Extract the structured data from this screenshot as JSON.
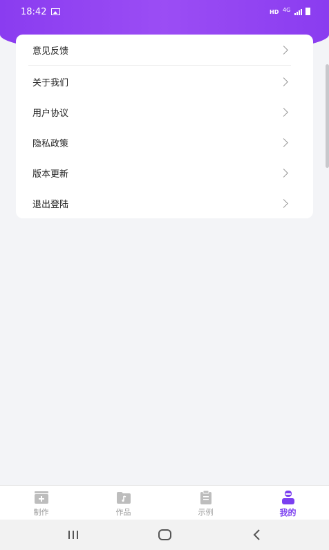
{
  "status_bar": {
    "time": "18:42",
    "hd": "HD",
    "network": "4G"
  },
  "menu": {
    "items": [
      {
        "label": "意见反馈"
      },
      {
        "label": "关于我们"
      },
      {
        "label": "用户协议"
      },
      {
        "label": "隐私政策"
      },
      {
        "label": "版本更新"
      },
      {
        "label": "退出登陆"
      }
    ]
  },
  "tabbar": {
    "tabs": [
      {
        "label": "制作",
        "icon": "add-media-icon"
      },
      {
        "label": "作品",
        "icon": "folder-icon"
      },
      {
        "label": "示例",
        "icon": "clipboard-icon"
      },
      {
        "label": "我的",
        "icon": "user-icon",
        "active": true
      }
    ]
  },
  "colors": {
    "accent": "#7b3ff0",
    "banner": "#8a3cf0",
    "background": "#f3f4f7"
  }
}
